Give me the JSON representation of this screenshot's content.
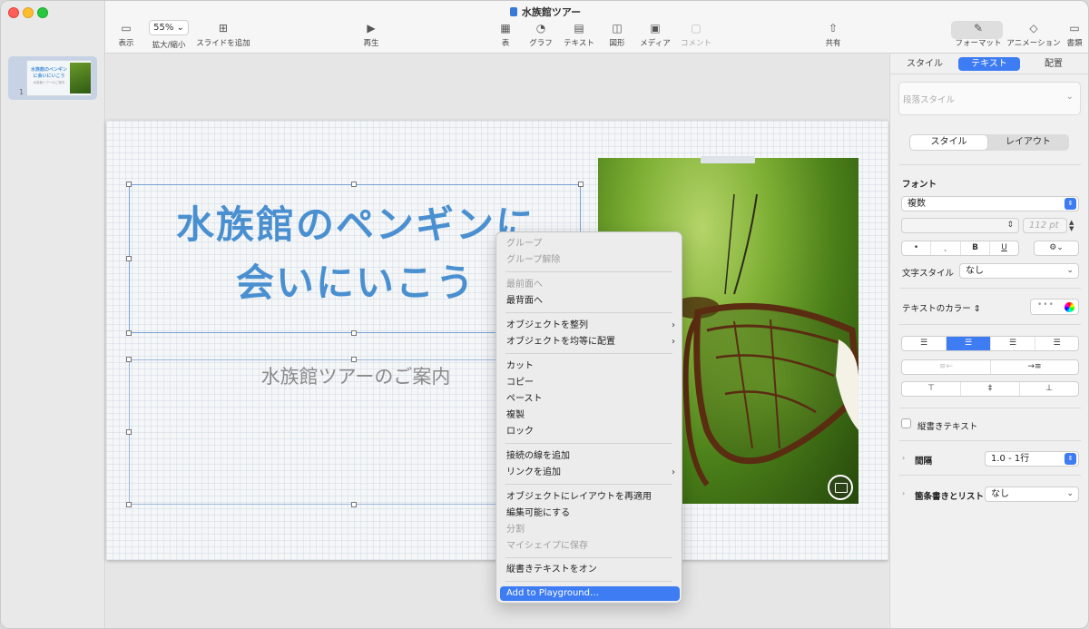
{
  "window": {
    "title": "水族館ツアー"
  },
  "toolbar": {
    "view": "表示",
    "zoom_value": "55%",
    "zoom_label": "拡大/縮小",
    "add_slide": "スライドを追加",
    "play": "再生",
    "table": "表",
    "chart": "グラフ",
    "text": "テキスト",
    "shape": "図形",
    "media": "メディア",
    "comment": "コメント",
    "share": "共有",
    "format": "フォーマット",
    "animate": "アニメーション",
    "document": "書類"
  },
  "navigator": {
    "slide_number": "1",
    "thumb_title": "水族館のペンギンに会いにいこう",
    "thumb_subtitle": "水族館ツアーのご案内"
  },
  "slide": {
    "title_line1": "水族館のペンギンに",
    "title_line2": "会いにいこう",
    "subtitle": "水族館ツアーのご案内"
  },
  "context_menu": {
    "items": [
      {
        "label": "グループ",
        "enabled": false
      },
      {
        "label": "グループ解除",
        "enabled": false
      },
      {
        "label": "最前面へ",
        "enabled": false
      },
      {
        "label": "最背面へ",
        "enabled": true
      },
      {
        "label": "オブジェクトを整列",
        "enabled": true,
        "submenu": true
      },
      {
        "label": "オブジェクトを均等に配置",
        "enabled": true,
        "submenu": true
      },
      {
        "label": "カット",
        "enabled": true
      },
      {
        "label": "コピー",
        "enabled": true
      },
      {
        "label": "ペースト",
        "enabled": true
      },
      {
        "label": "複製",
        "enabled": true
      },
      {
        "label": "ロック",
        "enabled": true
      },
      {
        "label": "接続の線を追加",
        "enabled": true
      },
      {
        "label": "リンクを追加",
        "enabled": true,
        "submenu": true
      },
      {
        "label": "オブジェクトにレイアウトを再適用",
        "enabled": true
      },
      {
        "label": "編集可能にする",
        "enabled": true
      },
      {
        "label": "分割",
        "enabled": false
      },
      {
        "label": "マイシェイプに保存",
        "enabled": false
      },
      {
        "label": "縦書きテキストをオン",
        "enabled": true
      },
      {
        "label": "Add to Playground…",
        "enabled": true,
        "highlighted": true
      }
    ]
  },
  "inspector": {
    "tabs": [
      "スタイル",
      "テキスト",
      "配置"
    ],
    "active_tab": "テキスト",
    "paragraph_style_placeholder": "段落スタイル",
    "subtabs": [
      "スタイル",
      "レイアウト"
    ],
    "font_label": "フォント",
    "font_value": "複数",
    "font_size": "112 pt",
    "bold": "B",
    "underline": "U",
    "char_style_label": "文字スタイル",
    "char_style_value": "なし",
    "text_color_label": "テキストのカラー",
    "vertical_text_label": "縦書きテキスト",
    "spacing_label": "間隔",
    "spacing_value": "1.0 - 1行",
    "bullets_label": "箇条書きとリスト",
    "bullets_value": "なし"
  }
}
